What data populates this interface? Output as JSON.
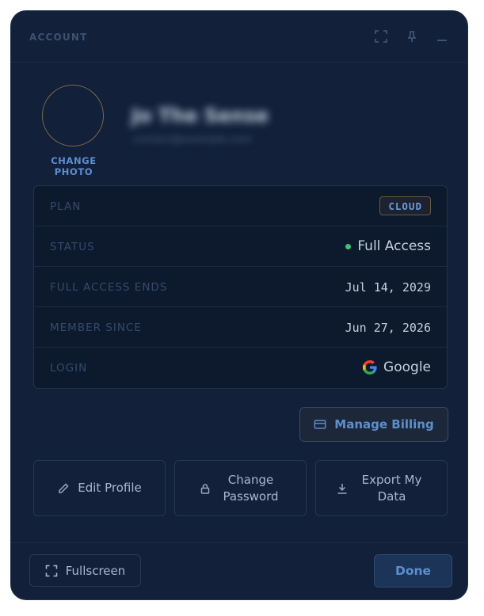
{
  "window": {
    "title": "ACCOUNT",
    "icons": [
      "expand-icon",
      "pin-icon",
      "minimize-icon"
    ]
  },
  "profile": {
    "change_photo_label": "CHANGE PHOTO",
    "name_blurred": "Jo The Sense",
    "email_blurred": "contact@example.com"
  },
  "details": {
    "rows": [
      {
        "label": "PLAN",
        "value": "CLOUD"
      },
      {
        "label": "STATUS",
        "value": "Full Access"
      },
      {
        "label": "FULL ACCESS ENDS",
        "value": "Jul 14, 2029"
      },
      {
        "label": "MEMBER SINCE",
        "value": "Jun 27, 2026"
      },
      {
        "label": "LOGIN",
        "value": "Google"
      }
    ]
  },
  "actions": {
    "manage_billing": "Manage Billing",
    "edit_profile": "Edit Profile",
    "change_password": "Change Password",
    "export_data": "Export My Data"
  },
  "footer": {
    "fullscreen": "Fullscreen",
    "done": "Done"
  },
  "colors": {
    "panel_bg": "#12203a",
    "accent": "#5d8ed0",
    "status_dot": "#3ec46d"
  }
}
